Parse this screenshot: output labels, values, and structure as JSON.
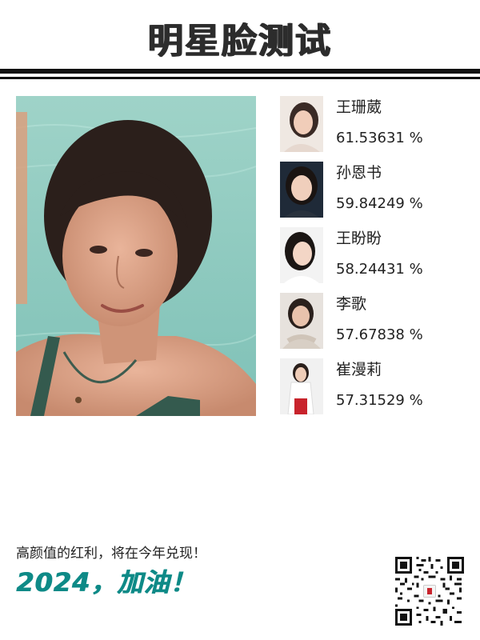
{
  "header": {
    "title": "明星脸测试"
  },
  "main_photo": {
    "icon": "portrait-photo"
  },
  "matches": [
    {
      "name": "王珊葳",
      "score": "61.53631 %",
      "icon": "celebrity-thumbnail"
    },
    {
      "name": "孙恩书",
      "score": "59.84249 %",
      "icon": "celebrity-thumbnail"
    },
    {
      "name": "王盼盼",
      "score": "58.24431 %",
      "icon": "celebrity-thumbnail"
    },
    {
      "name": "李歌",
      "score": "57.67838 %",
      "icon": "celebrity-thumbnail"
    },
    {
      "name": "崔漫莉",
      "score": "57.31529 %",
      "icon": "celebrity-thumbnail"
    }
  ],
  "footer": {
    "line": "高颜值的红利，将在今年兑现！",
    "slogan": "2024，加油！",
    "qr_icon": "qr-code"
  },
  "colors": {
    "accent": "#0e8a87",
    "rule": "#111111",
    "title": "#2c2c2c"
  }
}
